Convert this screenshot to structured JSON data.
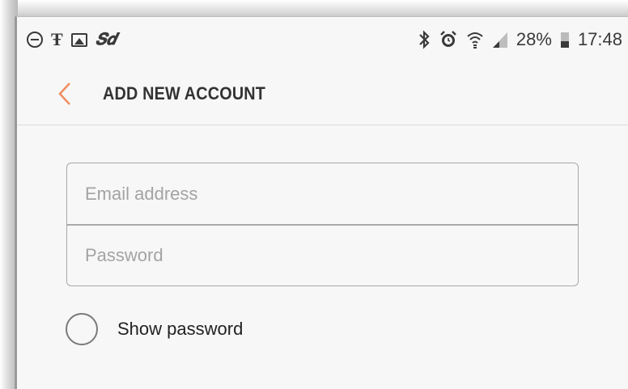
{
  "status_bar": {
    "left_icons": [
      "do-not-disturb-icon",
      "t-mobile-icon",
      "gallery-icon",
      "sd-card-icon"
    ],
    "right_icons": [
      "bluetooth-icon",
      "alarm-icon",
      "wifi-icon",
      "signal-icon",
      "battery-icon"
    ],
    "battery_percent": "28%",
    "time": "17:48"
  },
  "app_bar": {
    "back_icon": "chevron-left-icon",
    "title": "ADD NEW ACCOUNT"
  },
  "form": {
    "email_placeholder": "Email address",
    "email_value": "",
    "password_placeholder": "Password",
    "password_value": ""
  },
  "show_password": {
    "label": "Show password",
    "checked": false
  },
  "colors": {
    "accent": "#f08a5d",
    "background": "#f7f7f7",
    "text": "#333333",
    "placeholder": "#a3a3a3"
  }
}
